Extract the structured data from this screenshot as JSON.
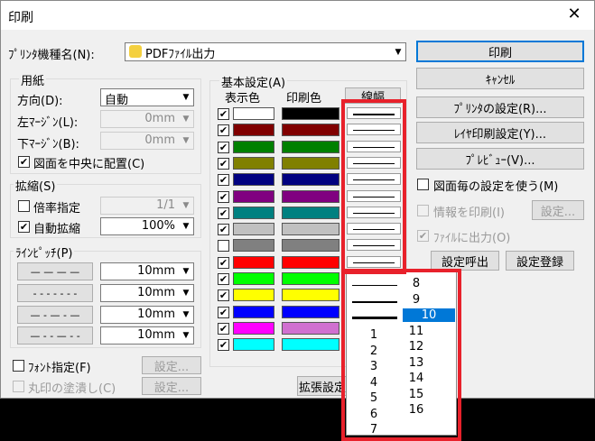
{
  "window": {
    "title": "印刷",
    "close": "✕"
  },
  "printer": {
    "label": "ﾌﾟﾘﾝﾀ機種名(N):",
    "value": "PDFﾌｧｲﾙ出力"
  },
  "buttons": {
    "print": "印刷",
    "cancel": "ｷｬﾝｾﾙ",
    "printer_settings": "ﾌﾟﾘﾝﾀの設定(R)...",
    "layer_settings": "ﾚｲﾔ印刷設定(Y)...",
    "preview": "ﾌﾟﾚﾋﾞｭｰ(V)...",
    "info_settings": "設定...",
    "recall": "設定呼出",
    "register": "設定登録",
    "font_settings": "設定...",
    "fill_settings": "設定...",
    "extend": "拡張設定"
  },
  "paper": {
    "group": "用紙",
    "direction_label": "方向(D):",
    "direction": "自動",
    "left_margin_label": "左ﾏｰｼﾞﾝ(L):",
    "left_margin": "0mm",
    "bottom_margin_label": "下ﾏｰｼﾞﾝ(B):",
    "bottom_margin": "0mm",
    "center_label": "図面を中央に配置(C)",
    "center_checked": "✔"
  },
  "scale": {
    "group": "拡縮(S)",
    "ratio_label": "倍率指定",
    "ratio": "1/1",
    "auto_label": "自動拡縮",
    "auto_checked": "✔",
    "auto_value": "100%"
  },
  "pitch": {
    "group": "ﾗｲﾝﾋﾟｯﾁ(P)",
    "rows": [
      {
        "pattern": "— — — —",
        "value": "10mm"
      },
      {
        "pattern": "- - - - - - -",
        "value": "10mm"
      },
      {
        "pattern": "— - — - —",
        "value": "10mm"
      },
      {
        "pattern": "— - - — - -",
        "value": "10mm"
      }
    ]
  },
  "font_label": "ﾌｫﾝﾄ指定(F)",
  "fill_label": "丸印の塗潰し(C)",
  "basic": {
    "group": "基本設定(A)",
    "col_display": "表示色",
    "col_print": "印刷色",
    "col_width": "線幅"
  },
  "colors": [
    {
      "check": "✔",
      "disp": "#ffffff",
      "print": "#000000"
    },
    {
      "check": "✔",
      "disp": "#800000",
      "print": "#800000"
    },
    {
      "check": "✔",
      "disp": "#008000",
      "print": "#008000"
    },
    {
      "check": "✔",
      "disp": "#808000",
      "print": "#808000"
    },
    {
      "check": "✔",
      "disp": "#000080",
      "print": "#000080"
    },
    {
      "check": "✔",
      "disp": "#800080",
      "print": "#800080"
    },
    {
      "check": "✔",
      "disp": "#008080",
      "print": "#008080"
    },
    {
      "check": "✔",
      "disp": "#c0c0c0",
      "print": "#c0c0c0"
    },
    {
      "check": "",
      "disp": "#808080",
      "print": "#808080"
    },
    {
      "check": "✔",
      "disp": "#ff0000",
      "print": "#ff0000"
    },
    {
      "check": "✔",
      "disp": "#00ff00",
      "print": "#00ff00"
    },
    {
      "check": "✔",
      "disp": "#ffff00",
      "print": "#ffff00"
    },
    {
      "check": "✔",
      "disp": "#0000ff",
      "print": "#0000ff"
    },
    {
      "check": "✔",
      "disp": "#ff00ff",
      "print": "#d070d0"
    },
    {
      "check": "✔",
      "disp": "#00ffff",
      "print": "#00ffff"
    }
  ],
  "right": {
    "per_drawing": "図面毎の設定を使う(M)",
    "print_info": "情報を印刷(I)",
    "file_output": "ﾌｧｲﾙに出力(O)",
    "file_output_checked": "✔"
  },
  "popup": {
    "left": [
      "1",
      "2",
      "3",
      "4",
      "5",
      "6",
      "7"
    ],
    "right": [
      "8",
      "9",
      "10",
      "11",
      "12",
      "13",
      "14",
      "15",
      "16"
    ],
    "selected": "10"
  }
}
